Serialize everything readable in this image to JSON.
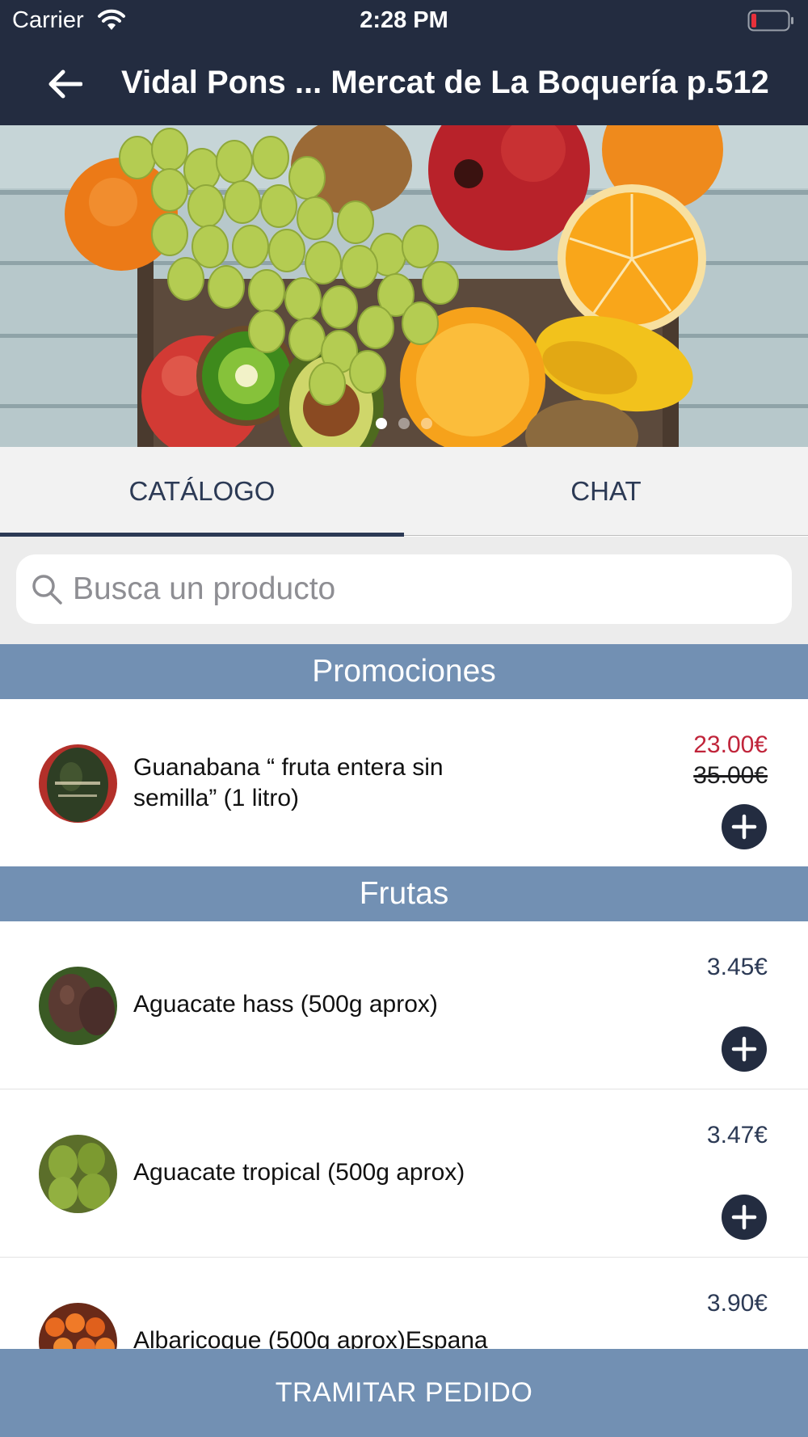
{
  "status_bar": {
    "carrier": "Carrier",
    "time": "2:28 PM"
  },
  "navbar": {
    "title": "Vidal Pons ... Mercat de La Boquería p.512",
    "back_icon": "arrow-left-icon"
  },
  "carousel": {
    "active_index": 0,
    "count": 3
  },
  "tabs": [
    {
      "label": "CATÁLOGO",
      "active": true
    },
    {
      "label": "CHAT",
      "active": false
    }
  ],
  "search": {
    "placeholder": "Busca un producto",
    "value": ""
  },
  "sections": {
    "promociones": "Promociones",
    "frutas": "Frutas"
  },
  "products": {
    "guanabana": {
      "name": "Guanabana “ fruta entera sin semilla” (1 litro)",
      "price": "23.00€",
      "old_price": "35.00€"
    },
    "aguacate_hass": {
      "name": "Aguacate hass (500g aprox)",
      "price": "3.45€"
    },
    "aguacate_tropical": {
      "name": "Aguacate tropical (500g aprox)",
      "price": "3.47€"
    },
    "albaricoque": {
      "name": "Albaricoque (500g aprox)Espana",
      "price": "3.90€"
    }
  },
  "cta": {
    "label": "TRAMITAR PEDIDO"
  },
  "colors": {
    "navbar": "#232c40",
    "section_header": "#7290b3",
    "promo_price": "#c0243a",
    "accent": "#2c3a55"
  }
}
